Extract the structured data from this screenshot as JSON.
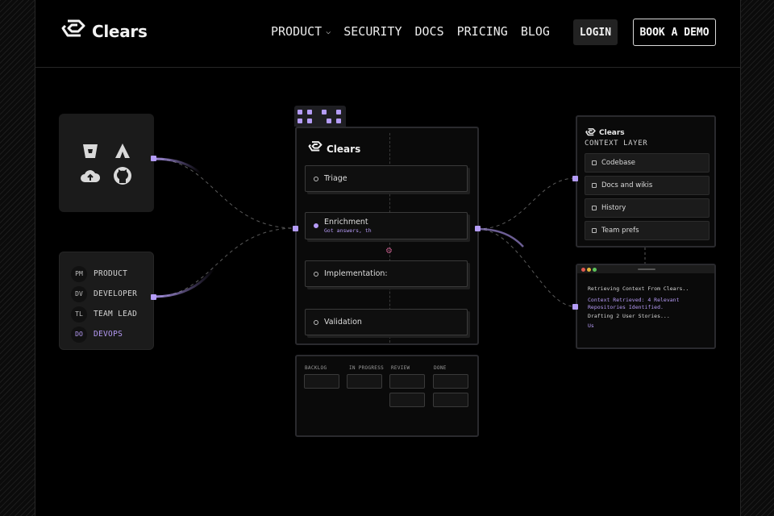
{
  "nav": {
    "brand": "Clears",
    "links": [
      {
        "label": "PRODUCT",
        "has_dropdown": true
      },
      {
        "label": "SECURITY"
      },
      {
        "label": "DOCS"
      },
      {
        "label": "PRICING"
      },
      {
        "label": "BLOG"
      }
    ],
    "login_label": "LOGIN",
    "demo_label": "BOOK A DEMO"
  },
  "tools": {
    "icons": [
      "bitbucket-icon",
      "atlassian-icon",
      "cloud-upload-icon",
      "github-icon"
    ]
  },
  "roles": [
    {
      "abbr": "PM",
      "label": "PRODUCT",
      "active": false
    },
    {
      "abbr": "DV",
      "label": "DEVELOPER",
      "active": false
    },
    {
      "abbr": "TL",
      "label": "TEAM LEAD",
      "active": false
    },
    {
      "abbr": "DO",
      "label": "DEVOPS",
      "active": true
    }
  ],
  "workflow": {
    "brand": "Clears",
    "steps": [
      {
        "label": "Triage",
        "sub": ""
      },
      {
        "label": "Enrichment",
        "sub": "Got answers, th"
      },
      {
        "label": "Implementation:",
        "sub": ""
      },
      {
        "label": "Validation",
        "sub": ""
      }
    ]
  },
  "board": {
    "columns": [
      "BACKLOG",
      "IN PROGRESS",
      "REVIEW",
      "DONE"
    ]
  },
  "context": {
    "brand": "Clears",
    "title": "CONTEXT LAYER",
    "items": [
      "Codebase",
      "Docs and wikis",
      "History",
      "Team prefs"
    ]
  },
  "terminal": {
    "lines": [
      "Retrieving Context From Clears..",
      "Context Retrieved: 4 Relevant",
      "Repositories Identified.",
      "Drafting 2 User Stories...",
      "Us"
    ]
  },
  "colors": {
    "accent": "#b49cf7",
    "background": "#000000",
    "panel": "#1b1b1b"
  }
}
